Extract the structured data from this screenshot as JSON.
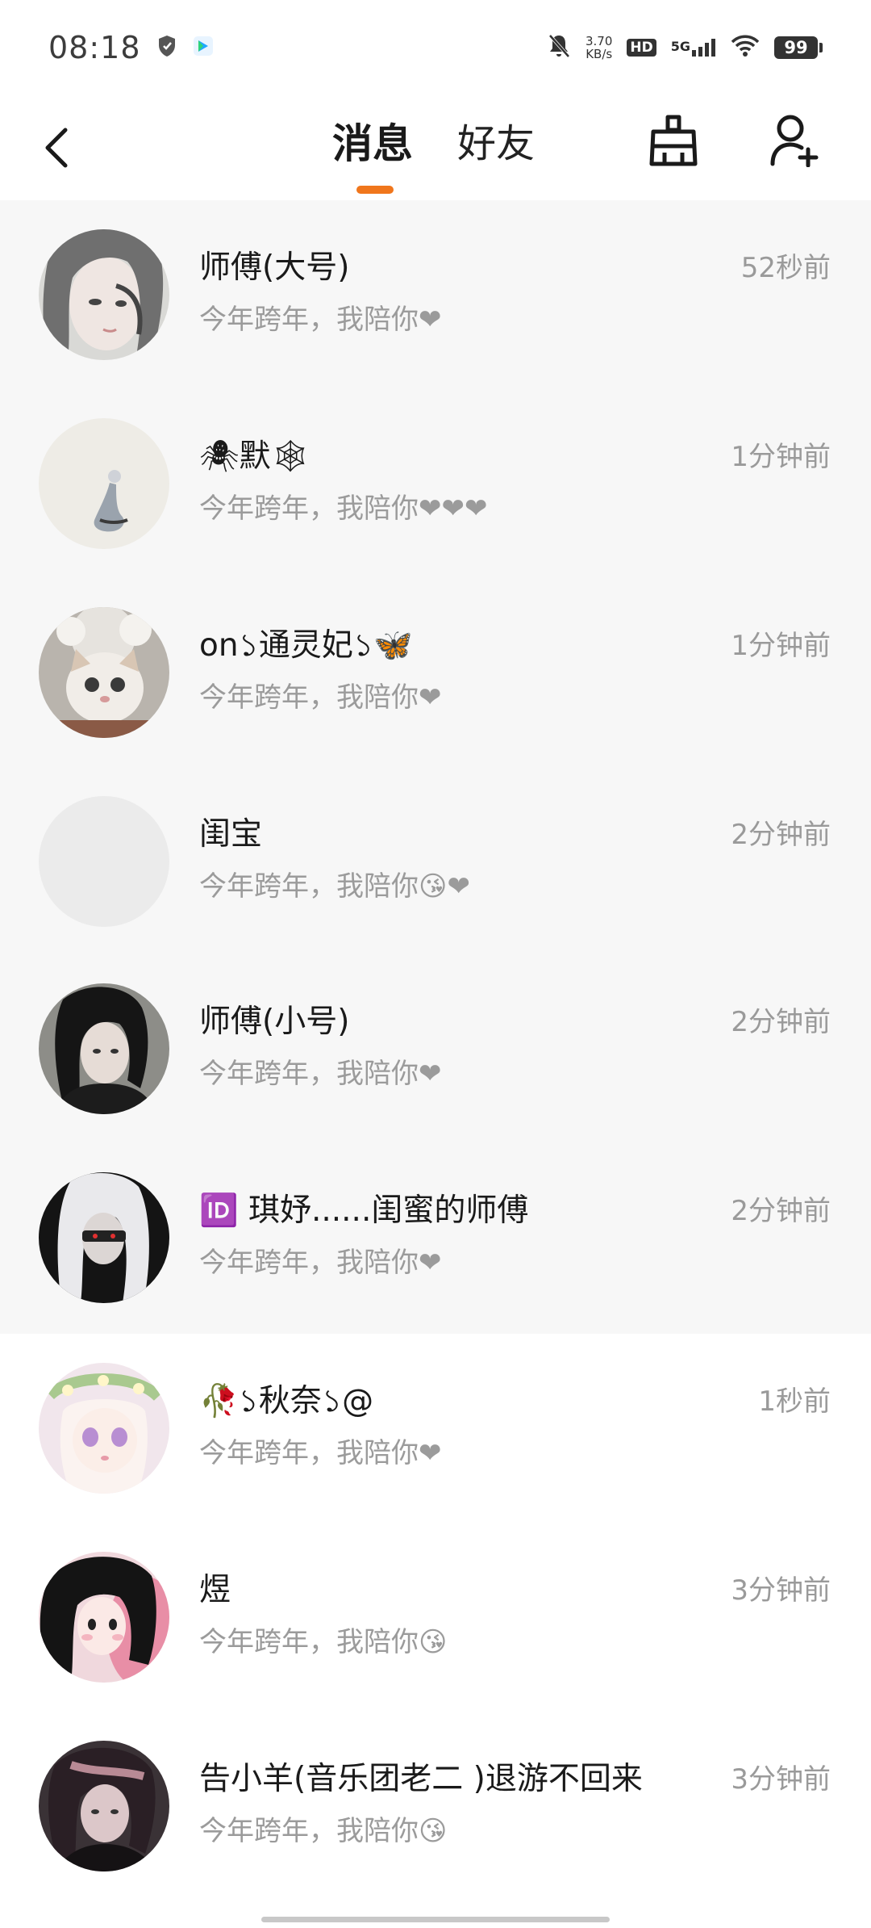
{
  "status_bar": {
    "time": "08:18",
    "net_speed_value": "3.70",
    "net_speed_unit": "KB/s",
    "hd_label": "HD",
    "network_label": "5G",
    "battery_level": "99",
    "icons": [
      "shield-icon",
      "app-notification-icon",
      "mute-bell-icon",
      "signal-icon",
      "wifi-icon",
      "battery-icon"
    ]
  },
  "header": {
    "tabs": [
      {
        "label": "消息",
        "active": true
      },
      {
        "label": "好友",
        "active": false
      }
    ],
    "accent_color": "#f0761c",
    "icons": [
      "back-arrow-icon",
      "broom-clean-icon",
      "add-friend-icon"
    ]
  },
  "conversations": [
    {
      "name": "师傅(大号)",
      "preview": "今年跨年，我陪你❤",
      "time": "52秒前"
    },
    {
      "name": "🕷默🕸",
      "preview": "今年跨年，我陪你❤❤❤",
      "time": "1分钟前"
    },
    {
      "name": "on১通灵妃১🦋",
      "preview": "今年跨年，我陪你❤",
      "time": "1分钟前"
    },
    {
      "name": "闺宝",
      "preview": "今年跨年，我陪你😘❤",
      "time": "2分钟前"
    },
    {
      "name": "师傅(小号)",
      "preview": "今年跨年，我陪你❤",
      "time": "2分钟前"
    },
    {
      "name": "🆔 琪妤......闺蜜的师傅",
      "preview": "今年跨年，我陪你❤",
      "time": "2分钟前"
    },
    {
      "name": "🥀১秋奈১@",
      "preview": "今年跨年，我陪你❤",
      "time": "1秒前"
    },
    {
      "name": "煜",
      "preview": "今年跨年，我陪你😘",
      "time": "3分钟前"
    },
    {
      "name": "告小羊(音乐团老二 )退游不回来",
      "preview": "今年跨年，我陪你😘",
      "time": "3分钟前"
    }
  ]
}
